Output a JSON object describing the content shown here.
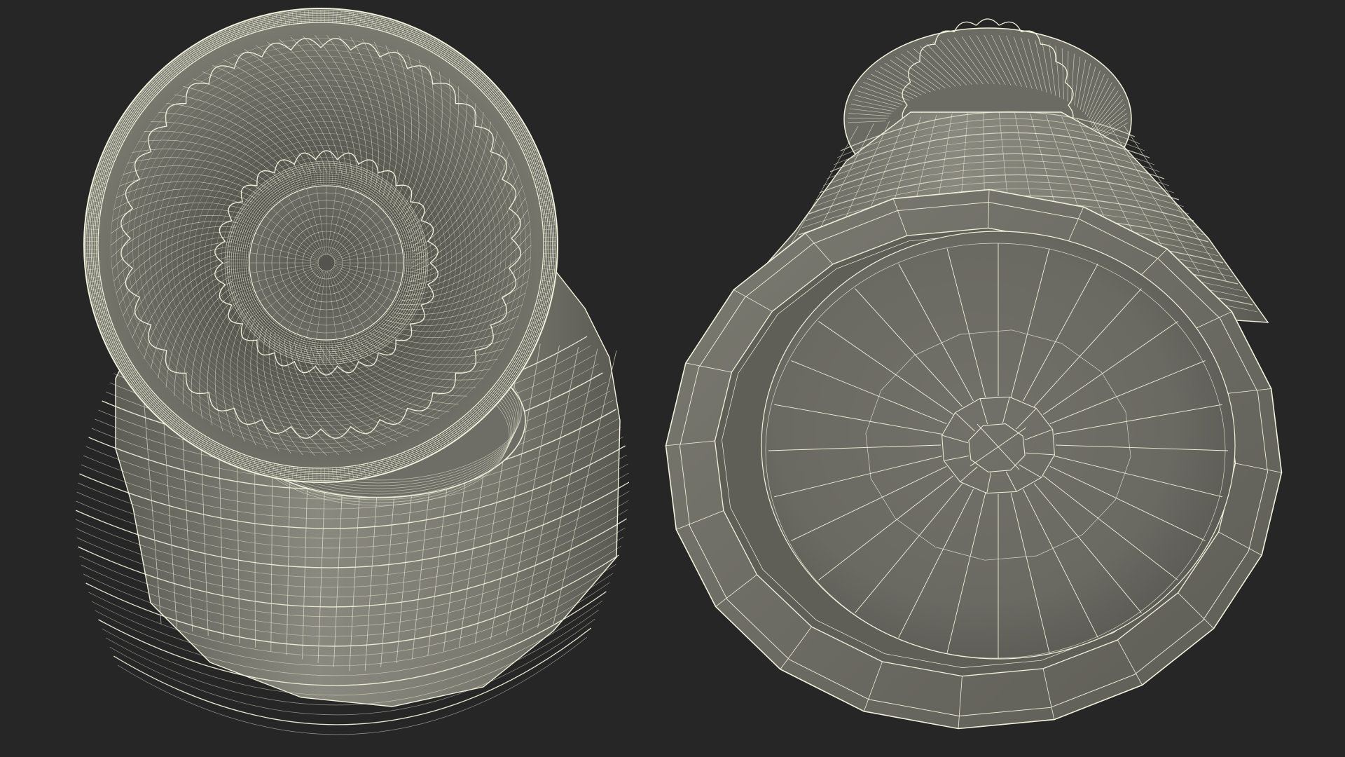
{
  "scene": {
    "background_color": "#262626",
    "wire_color": "#f2f2dc",
    "surface_light": "#8e8d82",
    "surface_mid": "#74736a",
    "surface_dark": "#55554f",
    "inner_light": "#7d7c72",
    "inner_dark": "#4a4a44",
    "views": [
      {
        "name": "top-view",
        "subject": "vase-wireframe-top"
      },
      {
        "name": "bottom-view",
        "subject": "vase-wireframe-bottom"
      }
    ]
  }
}
